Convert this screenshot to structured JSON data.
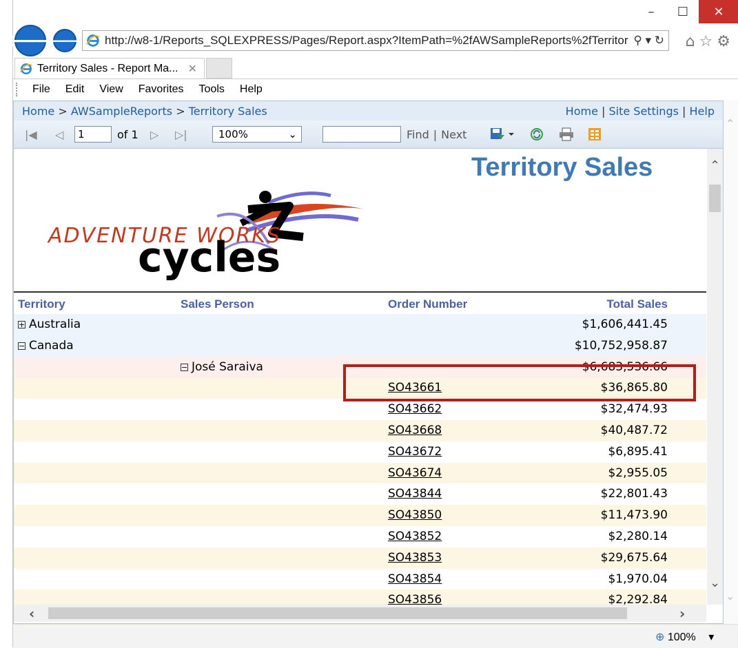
{
  "browser": {
    "window_controls": {
      "minimize": "–",
      "maximize": "☐",
      "close": "✕"
    },
    "address": "http://w8-1/Reports_SQLEXPRESS/Pages/Report.aspx?ItemPath=%2fAWSampleReports%2fTerritor",
    "address_tools": "⚲ ▾ ↻",
    "tab_title": "Territory Sales - Report Ma...",
    "tab_close": "✕",
    "menu": [
      "File",
      "Edit",
      "View",
      "Favorites",
      "Tools",
      "Help"
    ],
    "zoom_status": "100%"
  },
  "report_viewer": {
    "breadcrumb": {
      "home": "Home",
      "sep": ">",
      "folder": "AWSampleReports",
      "report": "Territory Sales"
    },
    "top_links": {
      "home": "Home",
      "site_settings": "Site Settings",
      "help": "Help",
      "sep": "|"
    },
    "toolbar": {
      "page_value": "1",
      "page_of": "of 1",
      "zoom_value": "100%",
      "find_label": "Find",
      "find_sep": "|",
      "next_label": "Next"
    }
  },
  "report": {
    "title": "Territory Sales",
    "logo_text": {
      "line1": "ADVENTURE WORKS",
      "line2": "cycles"
    },
    "columns": {
      "territory": "Territory",
      "sales_person": "Sales Person",
      "order_number": "Order Number",
      "total_sales": "Total Sales"
    },
    "groups": [
      {
        "label": "Australia",
        "toggle": "+",
        "total": "$1,606,441.45"
      },
      {
        "label": "Canada",
        "toggle": "−",
        "total": "$10,752,958.87"
      }
    ],
    "sales_person": {
      "label": "José Saraiva",
      "toggle": "−",
      "total": "$6,683,536.66"
    },
    "orders": [
      {
        "order": "SO43661",
        "total": "$36,865.80"
      },
      {
        "order": "SO43662",
        "total": "$32,474.93"
      },
      {
        "order": "SO43668",
        "total": "$40,487.72"
      },
      {
        "order": "SO43672",
        "total": "$6,895.41"
      },
      {
        "order": "SO43674",
        "total": "$2,955.05"
      },
      {
        "order": "SO43844",
        "total": "$22,801.43"
      },
      {
        "order": "SO43850",
        "total": "$11,473.90"
      },
      {
        "order": "SO43852",
        "total": "$2,280.14"
      },
      {
        "order": "SO43853",
        "total": "$29,675.64"
      },
      {
        "order": "SO43854",
        "total": "$1,970.04"
      },
      {
        "order": "SO43856",
        "total": "$2,292.84"
      }
    ]
  },
  "colors": {
    "title": "#3e7bb6",
    "header_text": "#4a5fa5",
    "highlight_border": "#b21e1e",
    "row_alt": "#fdf6e3",
    "group_row": "#eef4fb",
    "person_row": "#fdf0ec"
  }
}
